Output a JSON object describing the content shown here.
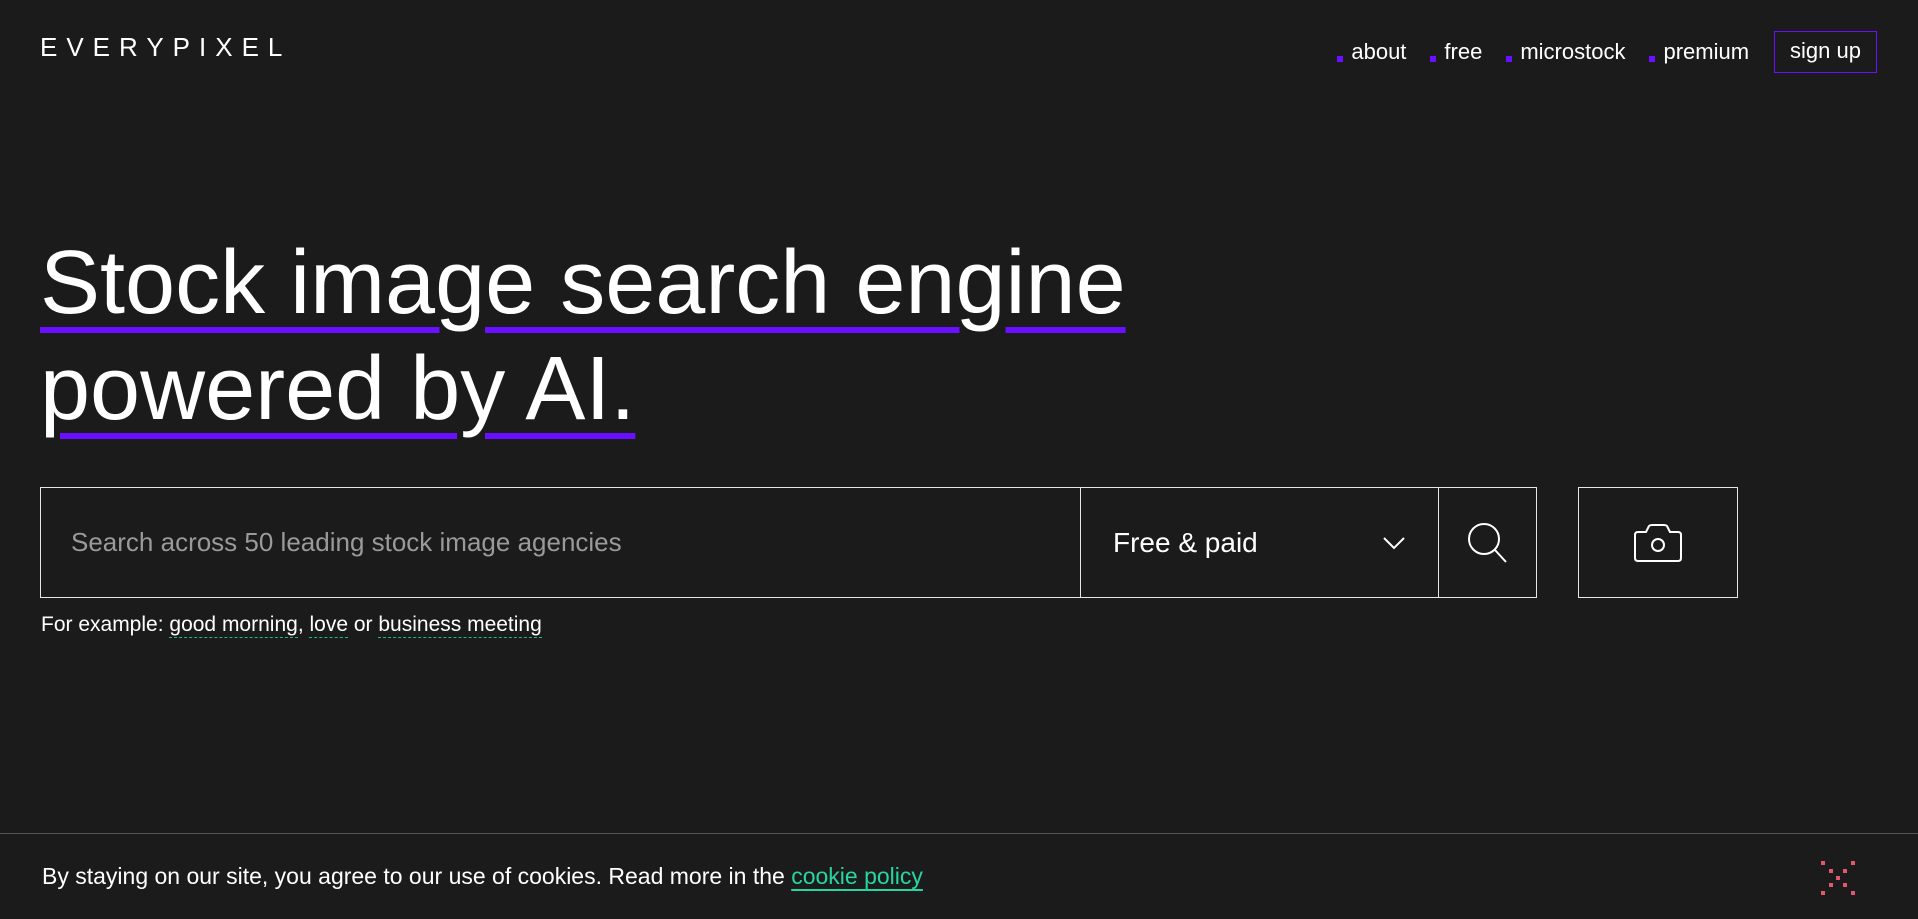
{
  "header": {
    "logo": "EVERYPIXEL",
    "nav": [
      {
        "label": "about"
      },
      {
        "label": "free"
      },
      {
        "label": "microstock"
      },
      {
        "label": "premium"
      }
    ],
    "signup_label": "sign up",
    "accent_color": "#6a0fff"
  },
  "hero": {
    "line1": "Stock image search engine",
    "line2": "powered by AI."
  },
  "search": {
    "placeholder": "Search across 50 leading stock image agencies",
    "value": "",
    "filter_selected": "Free & paid",
    "search_icon": "search-icon",
    "camera_icon": "camera-icon"
  },
  "examples": {
    "prefix": "For example: ",
    "items": [
      "good morning",
      "love",
      "business meeting"
    ],
    "sep1": ", ",
    "sep2": " or "
  },
  "cookie": {
    "text": "By staying on our site, you agree to our use of cookies. Read more in the ",
    "link": "cookie policy",
    "link_color": "#26d6a0",
    "close_icon": "close-icon",
    "close_color": "#e8566e"
  }
}
